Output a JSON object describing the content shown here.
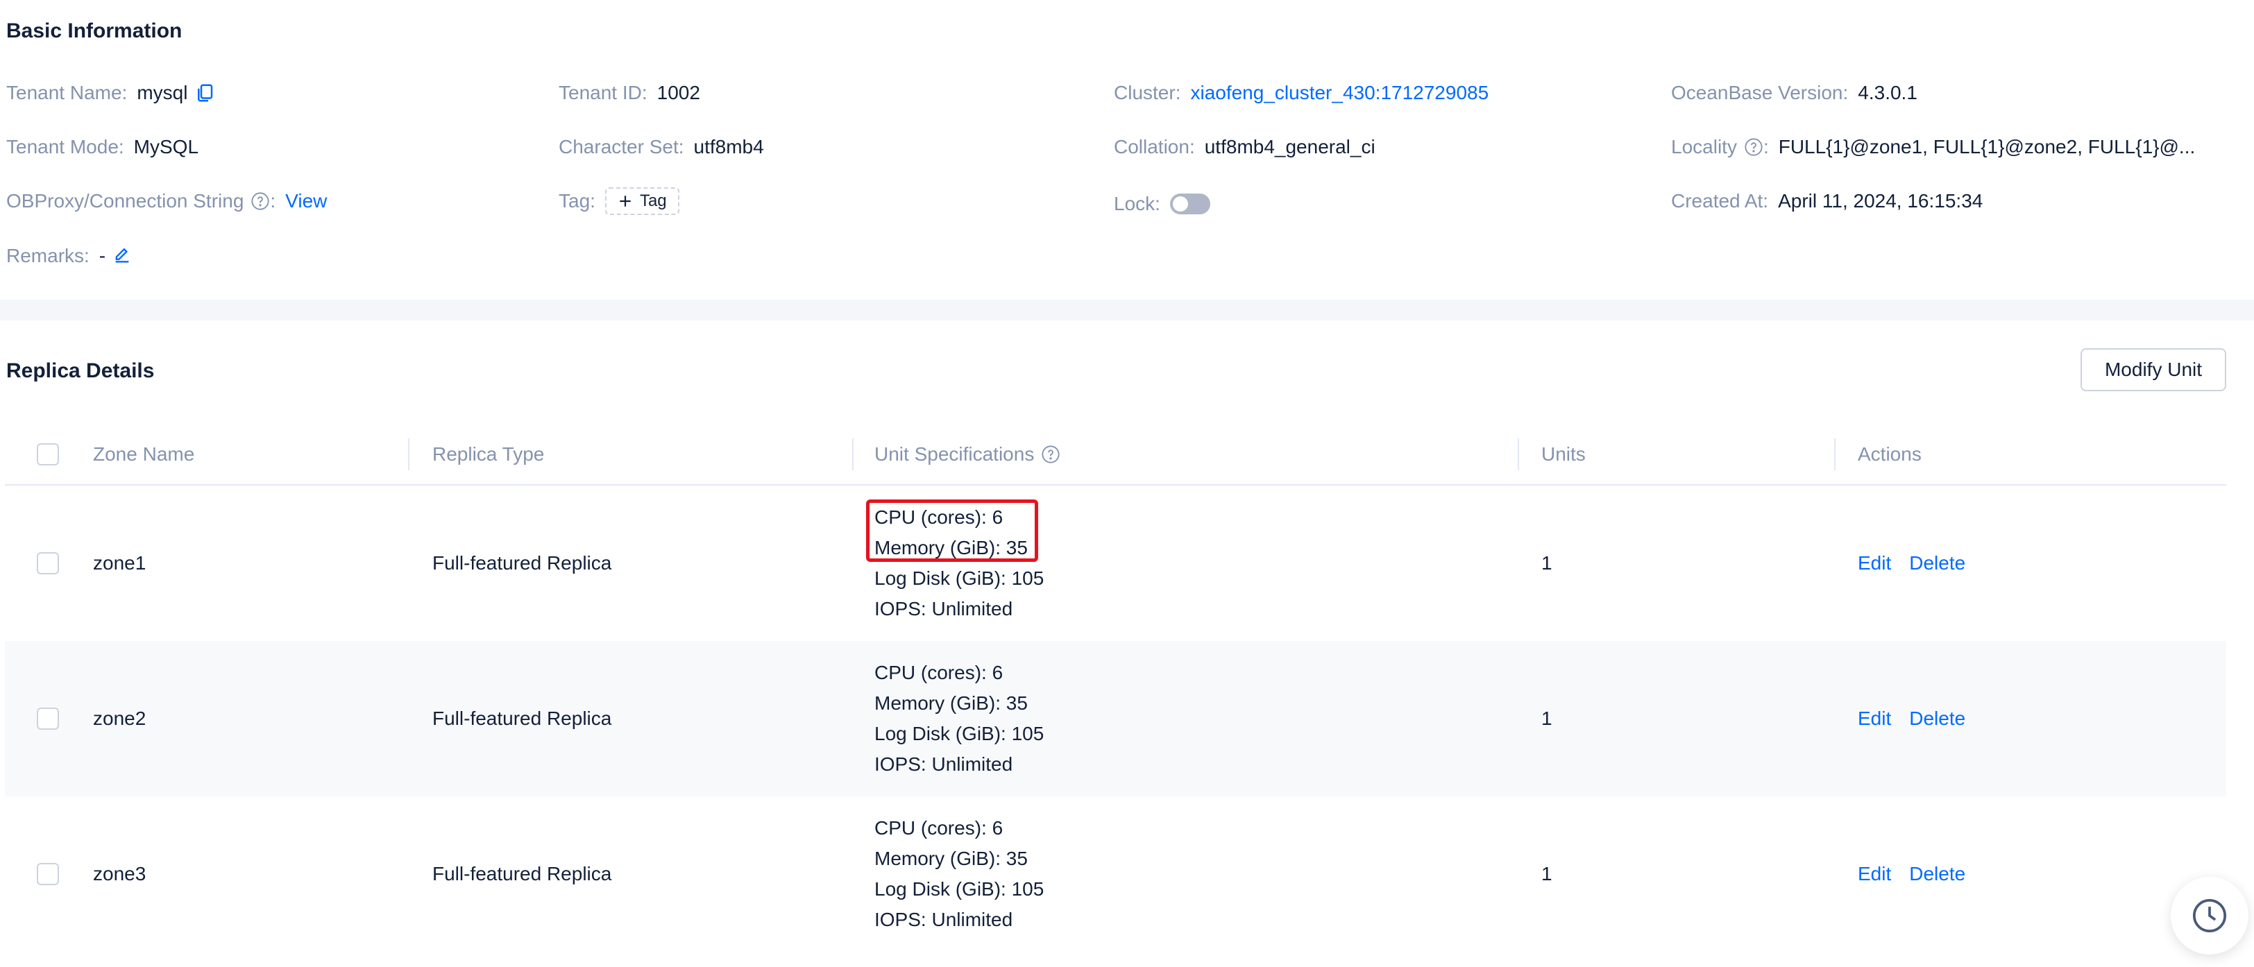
{
  "basic": {
    "title": "Basic Information",
    "tenant_name_label": "Tenant Name:",
    "tenant_name": "mysql",
    "tenant_id_label": "Tenant ID:",
    "tenant_id": "1002",
    "cluster_label": "Cluster:",
    "cluster": "xiaofeng_cluster_430:1712729085",
    "version_label": "OceanBase Version:",
    "version": "4.3.0.1",
    "mode_label": "Tenant Mode:",
    "mode": "MySQL",
    "charset_label": "Character Set:",
    "charset": "utf8mb4",
    "collation_label": "Collation",
    "collation": "utf8mb4_general_ci",
    "locality_label": "Locality",
    "locality": "FULL{1}@zone1, FULL{1}@zone2, FULL{1}@...",
    "obproxy_label": "OBProxy/Connection String",
    "obproxy_link": "View",
    "tag_label": "Tag:",
    "tag_button": "Tag",
    "lock_label": "Lock:",
    "lock_on": false,
    "created_label": "Created At:",
    "created": "April 11, 2024, 16:15:34",
    "remarks_label": "Remarks:",
    "remarks": "-"
  },
  "replica": {
    "title": "Replica Details",
    "modify_button": "Modify Unit",
    "columns": [
      "Zone Name",
      "Replica Type",
      "Unit Specifications",
      "Units",
      "Actions"
    ],
    "rows": [
      {
        "zone": "zone1",
        "type": "Full-featured Replica",
        "cpu": "CPU (cores): 6",
        "memory": "Memory (GiB): 35",
        "log_disk": "Log Disk (GiB): 105",
        "iops": "IOPS: Unlimited",
        "units": "1",
        "edit": "Edit",
        "delete": "Delete"
      },
      {
        "zone": "zone2",
        "type": "Full-featured Replica",
        "cpu": "CPU (cores): 6",
        "memory": "Memory (GiB): 35",
        "log_disk": "Log Disk (GiB): 105",
        "iops": "IOPS: Unlimited",
        "units": "1",
        "edit": "Edit",
        "delete": "Delete"
      },
      {
        "zone": "zone3",
        "type": "Full-featured Replica",
        "cpu": "CPU (cores): 6",
        "memory": "Memory (GiB): 35",
        "log_disk": "Log Disk (GiB): 105",
        "iops": "IOPS: Unlimited",
        "units": "1",
        "edit": "Edit",
        "delete": "Delete"
      }
    ]
  },
  "colors": {
    "link": "#006aff",
    "label": "#8592ad",
    "text": "#132039",
    "highlight": "#e8121d"
  },
  "icons": {
    "copy": "copy-icon",
    "help": "help-icon",
    "edit": "edit-icon",
    "plus": "plus-icon",
    "history": "history-icon"
  }
}
